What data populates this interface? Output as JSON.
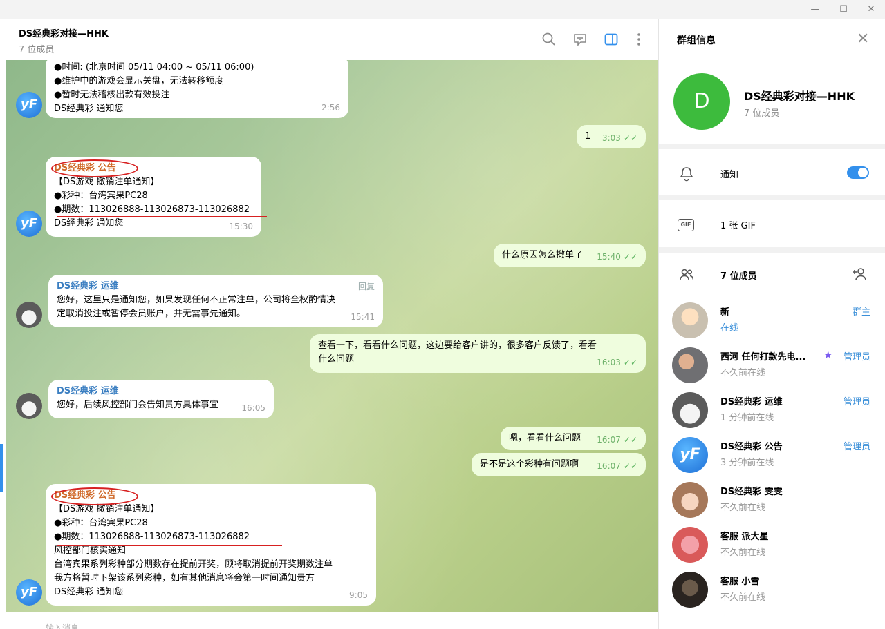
{
  "window": {
    "minimize": "—",
    "maximize": "☐",
    "close": "✕"
  },
  "chat": {
    "title": "DS经典彩对接—HHK",
    "members": "7 位成员",
    "input_placeholder": "输入消息..."
  },
  "messages": {
    "m1": {
      "lines": [
        "●时间: (北京时间 05/11 04:00 ~ 05/11 06:00)",
        "●维护中的游戏会显示关盘，无法转移额度",
        "●暂时无法稽核出款有效投注",
        "DS经典彩 通知您"
      ],
      "time": "2:56"
    },
    "m2": {
      "text": "1",
      "time": "3:03"
    },
    "m3": {
      "sender": "DS经典彩 公告",
      "lines": [
        "【DS游戏 撤销注单通知】",
        "●彩种：台湾宾果PC28",
        "●期数：113026888-113026873-113026882",
        "DS经典彩 通知您"
      ],
      "time": "15:30"
    },
    "m4": {
      "text": "什么原因怎么撤单了",
      "time": "15:40"
    },
    "m5": {
      "sender": "DS经典彩 运维",
      "reply": "回复",
      "lines": [
        "您好，这里只是通知您，如果发现任何不正常注单，公司将全权酌情决",
        "定取消投注或暂停会员账户，并无需事先通知。"
      ],
      "time": "15:41"
    },
    "m6": {
      "lines": [
        "查看一下，看看什么问题，这边要给客户讲的，很多客户反馈了，看看",
        "什么问题"
      ],
      "time": "16:03"
    },
    "m7": {
      "sender": "DS经典彩 运维",
      "text": "您好，后续风控部门会告知贵方具体事宜",
      "time": "16:05"
    },
    "m8": {
      "text": "嗯，看看什么问题",
      "time": "16:07"
    },
    "m9": {
      "text": "是不是这个彩种有问题啊",
      "time": "16:07"
    },
    "m10": {
      "sender": "DS经典彩 公告",
      "lines": [
        "【DS游戏 撤销注单通知】",
        "●彩种：台湾宾果PC28",
        "●期数：113026888-113026873-113026882",
        "风控部门核实通知",
        "台湾宾果系列彩种部分期数存在提前开奖，顾将取消提前开奖期数注单",
        "我方将暂时下架该系列彩种，如有其他消息将会第一时间通知贵方",
        "DS经典彩 通知您"
      ],
      "time": "9:05"
    },
    "check_mark": "✓✓",
    "avatar_label": "yF"
  },
  "panel": {
    "title": "群组信息",
    "group_initial": "D",
    "group_name": "DS经典彩对接—HHK",
    "group_members": "7 位成员",
    "notifications_label": "通知",
    "notifications_on": true,
    "gif_label": "1 张 GIF",
    "gif_icon_text": "GIF",
    "members_label": "7 位成员",
    "members": [
      {
        "name": "新",
        "status": "在线",
        "role": "群主"
      },
      {
        "name": "西河 任何打款先电...",
        "status": "不久前在线",
        "role": "管理员"
      },
      {
        "name": "DS经典彩 运维",
        "status": "1 分钟前在线",
        "role": "管理员"
      },
      {
        "name": "DS经典彩 公告",
        "status": "3 分钟前在线",
        "role": "管理员"
      },
      {
        "name": "DS经典彩 雯雯",
        "status": "不久前在线",
        "role": ""
      },
      {
        "name": "客服 派大星",
        "status": "不久前在线",
        "role": ""
      },
      {
        "name": "客服 小雪",
        "status": "不久前在线",
        "role": ""
      }
    ]
  },
  "colors": {
    "accent": "#3390ec",
    "outgoing_bubble": "#effdde",
    "annotation_red": "#d72121",
    "group_avatar": "#3dbb3d"
  }
}
